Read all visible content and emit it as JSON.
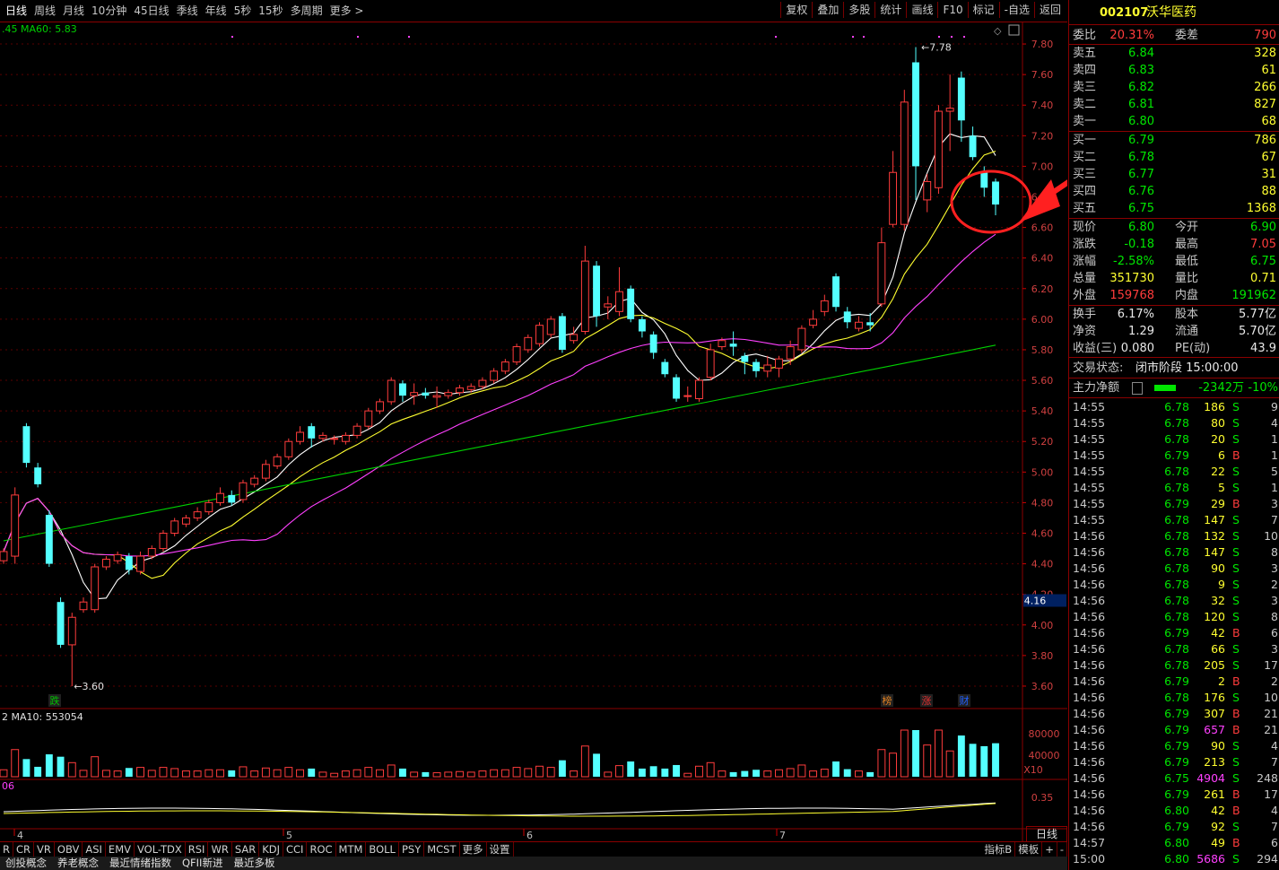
{
  "toolbar": {
    "periods": [
      "日线",
      "周线",
      "月线",
      "10分钟",
      "45日线",
      "季线",
      "年线",
      "5秒",
      "15秒",
      "多周期",
      "更多 >"
    ],
    "actions": [
      "复权",
      "叠加",
      "多股",
      "统计",
      "画线",
      "F10",
      "标记",
      "-自选",
      "返回"
    ]
  },
  "chart": {
    "ma_legend": ".45  MA60: 5.83",
    "vol_legend": "2  MA10: 553054",
    "macd_legend": "06",
    "price_axis": [
      "7.80",
      "7.60",
      "7.40",
      "7.20",
      "7.00",
      "6.80",
      "6.60",
      "6.40",
      "6.20",
      "6.00",
      "5.80",
      "5.60",
      "5.40",
      "5.20",
      "5.00",
      "4.80",
      "4.60",
      "4.40",
      "4.20",
      "4.00",
      "3.80",
      "3.60"
    ],
    "price_marker": "4.16",
    "vol_axis": [
      "80000",
      "40000",
      "X10"
    ],
    "macd_axis": [
      "0.35"
    ],
    "high_label": "7.78",
    "low_label": "3.60",
    "month_labels": [
      "4",
      "5",
      "6",
      "7"
    ],
    "event_tags": [
      "跌",
      "榜",
      "涨",
      "财"
    ],
    "period_btn": "日线",
    "chart_data": {
      "type": "candlestick",
      "ylim": [
        3.5,
        7.9
      ],
      "candles": [
        {
          "o": 4.42,
          "c": 4.48,
          "h": 4.5,
          "l": 4.4
        },
        {
          "o": 4.45,
          "c": 4.85,
          "h": 4.9,
          "l": 4.4
        },
        {
          "o": 5.3,
          "c": 5.06,
          "h": 5.32,
          "l": 5.03
        },
        {
          "o": 5.03,
          "c": 4.92,
          "h": 5.06,
          "l": 4.9
        },
        {
          "o": 4.72,
          "c": 4.4,
          "h": 4.75,
          "l": 4.38
        },
        {
          "o": 4.15,
          "c": 3.87,
          "h": 4.18,
          "l": 3.85
        },
        {
          "o": 3.87,
          "c": 4.05,
          "h": 4.08,
          "l": 3.6
        },
        {
          "o": 4.1,
          "c": 4.15,
          "h": 4.18,
          "l": 4.08
        },
        {
          "o": 4.1,
          "c": 4.38,
          "h": 4.4,
          "l": 4.08
        },
        {
          "o": 4.38,
          "c": 4.43,
          "h": 4.45,
          "l": 4.36
        },
        {
          "o": 4.42,
          "c": 4.46,
          "h": 4.48,
          "l": 4.4
        },
        {
          "o": 4.45,
          "c": 4.36,
          "h": 4.47,
          "l": 4.33
        },
        {
          "o": 4.35,
          "c": 4.45,
          "h": 4.48,
          "l": 4.33
        },
        {
          "o": 4.45,
          "c": 4.5,
          "h": 4.52,
          "l": 4.43
        },
        {
          "o": 4.5,
          "c": 4.6,
          "h": 4.62,
          "l": 4.48
        },
        {
          "o": 4.6,
          "c": 4.68,
          "h": 4.7,
          "l": 4.58
        },
        {
          "o": 4.66,
          "c": 4.7,
          "h": 4.72,
          "l": 4.64
        },
        {
          "o": 4.7,
          "c": 4.74,
          "h": 4.77,
          "l": 4.68
        },
        {
          "o": 4.74,
          "c": 4.8,
          "h": 4.82,
          "l": 4.72
        },
        {
          "o": 4.8,
          "c": 4.86,
          "h": 4.9,
          "l": 4.78
        },
        {
          "o": 4.85,
          "c": 4.8,
          "h": 4.88,
          "l": 4.78
        },
        {
          "o": 4.82,
          "c": 4.93,
          "h": 4.95,
          "l": 4.8
        },
        {
          "o": 4.92,
          "c": 4.96,
          "h": 4.98,
          "l": 4.9
        },
        {
          "o": 4.96,
          "c": 5.05,
          "h": 5.08,
          "l": 4.94
        },
        {
          "o": 5.04,
          "c": 5.1,
          "h": 5.12,
          "l": 5.02
        },
        {
          "o": 5.1,
          "c": 5.2,
          "h": 5.22,
          "l": 5.08
        },
        {
          "o": 5.2,
          "c": 5.26,
          "h": 5.3,
          "l": 5.18
        },
        {
          "o": 5.3,
          "c": 5.22,
          "h": 5.32,
          "l": 5.16
        },
        {
          "o": 5.22,
          "c": 5.24,
          "h": 5.26,
          "l": 5.2
        },
        {
          "o": 5.22,
          "c": 5.22,
          "h": 5.24,
          "l": 5.18
        },
        {
          "o": 5.2,
          "c": 5.24,
          "h": 5.26,
          "l": 5.18
        },
        {
          "o": 5.24,
          "c": 5.3,
          "h": 5.32,
          "l": 5.22
        },
        {
          "o": 5.3,
          "c": 5.4,
          "h": 5.42,
          "l": 5.28
        },
        {
          "o": 5.4,
          "c": 5.46,
          "h": 5.48,
          "l": 5.38
        },
        {
          "o": 5.46,
          "c": 5.6,
          "h": 5.62,
          "l": 5.44
        },
        {
          "o": 5.58,
          "c": 5.5,
          "h": 5.6,
          "l": 5.46
        },
        {
          "o": 5.5,
          "c": 5.52,
          "h": 5.58,
          "l": 5.44
        },
        {
          "o": 5.52,
          "c": 5.5,
          "h": 5.55,
          "l": 5.48
        },
        {
          "o": 5.49,
          "c": 5.5,
          "h": 5.56,
          "l": 5.42
        },
        {
          "o": 5.5,
          "c": 5.52,
          "h": 5.54,
          "l": 5.48
        },
        {
          "o": 5.52,
          "c": 5.55,
          "h": 5.57,
          "l": 5.5
        },
        {
          "o": 5.54,
          "c": 5.56,
          "h": 5.58,
          "l": 5.52
        },
        {
          "o": 5.56,
          "c": 5.6,
          "h": 5.62,
          "l": 5.54
        },
        {
          "o": 5.6,
          "c": 5.66,
          "h": 5.68,
          "l": 5.58
        },
        {
          "o": 5.66,
          "c": 5.72,
          "h": 5.74,
          "l": 5.64
        },
        {
          "o": 5.72,
          "c": 5.82,
          "h": 5.84,
          "l": 5.7
        },
        {
          "o": 5.8,
          "c": 5.88,
          "h": 5.9,
          "l": 5.78
        },
        {
          "o": 5.84,
          "c": 5.96,
          "h": 5.98,
          "l": 5.82
        },
        {
          "o": 5.9,
          "c": 6.0,
          "h": 6.02,
          "l": 5.88
        },
        {
          "o": 6.02,
          "c": 5.8,
          "h": 6.04,
          "l": 5.78
        },
        {
          "o": 5.86,
          "c": 5.9,
          "h": 5.95,
          "l": 5.84
        },
        {
          "o": 5.92,
          "c": 6.38,
          "h": 6.48,
          "l": 5.9
        },
        {
          "o": 6.35,
          "c": 6.02,
          "h": 6.38,
          "l": 5.95
        },
        {
          "o": 6.08,
          "c": 6.1,
          "h": 6.15,
          "l": 6.0
        },
        {
          "o": 6.05,
          "c": 6.18,
          "h": 6.34,
          "l": 6.02
        },
        {
          "o": 6.2,
          "c": 6.0,
          "h": 6.22,
          "l": 5.98
        },
        {
          "o": 6.0,
          "c": 5.92,
          "h": 6.02,
          "l": 5.88
        },
        {
          "o": 5.9,
          "c": 5.78,
          "h": 5.92,
          "l": 5.74
        },
        {
          "o": 5.72,
          "c": 5.64,
          "h": 5.74,
          "l": 5.62
        },
        {
          "o": 5.62,
          "c": 5.48,
          "h": 5.64,
          "l": 5.46
        },
        {
          "o": 5.5,
          "c": 5.5,
          "h": 5.56,
          "l": 5.46
        },
        {
          "o": 5.48,
          "c": 5.6,
          "h": 5.62,
          "l": 5.46
        },
        {
          "o": 5.62,
          "c": 5.8,
          "h": 5.84,
          "l": 5.6
        },
        {
          "o": 5.82,
          "c": 5.86,
          "h": 5.88,
          "l": 5.8
        },
        {
          "o": 5.84,
          "c": 5.82,
          "h": 5.92,
          "l": 5.76
        },
        {
          "o": 5.76,
          "c": 5.72,
          "h": 5.78,
          "l": 5.64
        },
        {
          "o": 5.72,
          "c": 5.66,
          "h": 5.74,
          "l": 5.62
        },
        {
          "o": 5.66,
          "c": 5.7,
          "h": 5.76,
          "l": 5.62
        },
        {
          "o": 5.68,
          "c": 5.74,
          "h": 5.76,
          "l": 5.62
        },
        {
          "o": 5.74,
          "c": 5.82,
          "h": 5.86,
          "l": 5.7
        },
        {
          "o": 5.8,
          "c": 5.94,
          "h": 5.96,
          "l": 5.78
        },
        {
          "o": 5.96,
          "c": 6.0,
          "h": 6.06,
          "l": 5.94
        },
        {
          "o": 6.05,
          "c": 6.12,
          "h": 6.16,
          "l": 6.02
        },
        {
          "o": 6.28,
          "c": 6.08,
          "h": 6.3,
          "l": 6.05
        },
        {
          "o": 6.05,
          "c": 5.98,
          "h": 6.08,
          "l": 5.94
        },
        {
          "o": 5.94,
          "c": 5.98,
          "h": 6.02,
          "l": 5.92
        },
        {
          "o": 5.98,
          "c": 5.96,
          "h": 6.04,
          "l": 5.92
        },
        {
          "o": 6.1,
          "c": 6.5,
          "h": 6.6,
          "l": 6.08
        },
        {
          "o": 6.62,
          "c": 6.96,
          "h": 7.1,
          "l": 6.6
        },
        {
          "o": 6.62,
          "c": 7.42,
          "h": 7.5,
          "l": 6.58
        },
        {
          "o": 7.68,
          "c": 7.0,
          "h": 7.78,
          "l": 6.78
        },
        {
          "o": 6.78,
          "c": 6.9,
          "h": 6.95,
          "l": 6.7
        },
        {
          "o": 6.86,
          "c": 7.36,
          "h": 7.4,
          "l": 6.82
        },
        {
          "o": 7.36,
          "c": 7.38,
          "h": 7.6,
          "l": 7.1
        },
        {
          "o": 7.58,
          "c": 7.3,
          "h": 7.62,
          "l": 7.16
        },
        {
          "o": 7.2,
          "c": 7.06,
          "h": 7.26,
          "l": 7.04
        },
        {
          "o": 6.96,
          "c": 6.86,
          "h": 7.0,
          "l": 6.8
        },
        {
          "o": 6.9,
          "c": 6.75,
          "h": 6.92,
          "l": 6.68
        }
      ],
      "ma5_color": "#ffffff",
      "ma10_color": "#ffff30",
      "ma20_color": "#ff40ff",
      "ma60_color": "#00d000",
      "volume_max": 110000
    }
  },
  "panel": {
    "code": "002107",
    "name": "沃华医药",
    "weibi_label": "委比",
    "weibi": "20.31%",
    "weicha_label": "委差",
    "weicha": "790",
    "asks": [
      {
        "label": "卖五",
        "price": "6.84",
        "vol": "328"
      },
      {
        "label": "卖四",
        "price": "6.83",
        "vol": "61"
      },
      {
        "label": "卖三",
        "price": "6.82",
        "vol": "266"
      },
      {
        "label": "卖二",
        "price": "6.81",
        "vol": "827"
      },
      {
        "label": "卖一",
        "price": "6.80",
        "vol": "68"
      }
    ],
    "bids": [
      {
        "label": "买一",
        "price": "6.79",
        "vol": "786"
      },
      {
        "label": "买二",
        "price": "6.78",
        "vol": "67"
      },
      {
        "label": "买三",
        "price": "6.77",
        "vol": "31"
      },
      {
        "label": "买四",
        "price": "6.76",
        "vol": "88"
      },
      {
        "label": "买五",
        "price": "6.75",
        "vol": "1368"
      }
    ],
    "stats": [
      {
        "l1": "现价",
        "v1": "6.80",
        "c1": "grn",
        "l2": "今开",
        "v2": "6.90",
        "c2": "grn"
      },
      {
        "l1": "涨跌",
        "v1": "-0.18",
        "c1": "grn",
        "l2": "最高",
        "v2": "7.05",
        "c2": "red"
      },
      {
        "l1": "涨幅",
        "v1": "-2.58%",
        "c1": "grn",
        "l2": "最低",
        "v2": "6.75",
        "c2": "grn"
      },
      {
        "l1": "总量",
        "v1": "351730",
        "c1": "yel",
        "l2": "量比",
        "v2": "0.71",
        "c2": "yel"
      },
      {
        "l1": "外盘",
        "v1": "159768",
        "c1": "red",
        "l2": "内盘",
        "v2": "191962",
        "c2": "grn"
      }
    ],
    "fund": [
      {
        "l1": "换手",
        "v1": "6.17%",
        "l2": "股本",
        "v2": "5.77亿"
      },
      {
        "l1": "净资",
        "v1": "1.29",
        "l2": "流通",
        "v2": "5.70亿"
      },
      {
        "l1": "收益(三)",
        "v1": "0.080",
        "l2": "PE(动)",
        "v2": "43.9"
      }
    ],
    "trade_status_label": "交易状态:",
    "trade_status": "闭市阶段 15:00:00",
    "main_flow_label": "主力净额",
    "main_flow": "-2342万",
    "main_flow_pct": "-10%",
    "ticks": [
      {
        "t": "14:55",
        "p": "6.78",
        "q": "186",
        "d": "S",
        "n": "9"
      },
      {
        "t": "14:55",
        "p": "6.78",
        "q": "80",
        "d": "S",
        "n": "4"
      },
      {
        "t": "14:55",
        "p": "6.78",
        "q": "20",
        "d": "S",
        "n": "1"
      },
      {
        "t": "14:55",
        "p": "6.79",
        "q": "6",
        "d": "B",
        "n": "1"
      },
      {
        "t": "14:55",
        "p": "6.78",
        "q": "22",
        "d": "S",
        "n": "5"
      },
      {
        "t": "14:55",
        "p": "6.78",
        "q": "5",
        "d": "S",
        "n": "1"
      },
      {
        "t": "14:55",
        "p": "6.79",
        "q": "29",
        "d": "B",
        "n": "3"
      },
      {
        "t": "14:55",
        "p": "6.78",
        "q": "147",
        "d": "S",
        "n": "7"
      },
      {
        "t": "14:56",
        "p": "6.78",
        "q": "132",
        "d": "S",
        "n": "10"
      },
      {
        "t": "14:56",
        "p": "6.78",
        "q": "147",
        "d": "S",
        "n": "8"
      },
      {
        "t": "14:56",
        "p": "6.78",
        "q": "90",
        "d": "S",
        "n": "3"
      },
      {
        "t": "14:56",
        "p": "6.78",
        "q": "9",
        "d": "S",
        "n": "2"
      },
      {
        "t": "14:56",
        "p": "6.78",
        "q": "32",
        "d": "S",
        "n": "3"
      },
      {
        "t": "14:56",
        "p": "6.78",
        "q": "120",
        "d": "S",
        "n": "8"
      },
      {
        "t": "14:56",
        "p": "6.79",
        "q": "42",
        "d": "B",
        "n": "6"
      },
      {
        "t": "14:56",
        "p": "6.78",
        "q": "66",
        "d": "S",
        "n": "3"
      },
      {
        "t": "14:56",
        "p": "6.78",
        "q": "205",
        "d": "S",
        "n": "17"
      },
      {
        "t": "14:56",
        "p": "6.79",
        "q": "2",
        "d": "B",
        "n": "2"
      },
      {
        "t": "14:56",
        "p": "6.78",
        "q": "176",
        "d": "S",
        "n": "10"
      },
      {
        "t": "14:56",
        "p": "6.79",
        "q": "307",
        "d": "B",
        "n": "21"
      },
      {
        "t": "14:56",
        "p": "6.79",
        "q": "657",
        "d": "B",
        "n": "21"
      },
      {
        "t": "14:56",
        "p": "6.79",
        "q": "90",
        "d": "S",
        "n": "4"
      },
      {
        "t": "14:56",
        "p": "6.79",
        "q": "213",
        "d": "S",
        "n": "7"
      },
      {
        "t": "14:56",
        "p": "6.75",
        "q": "4904",
        "d": "S",
        "n": "248"
      },
      {
        "t": "14:56",
        "p": "6.79",
        "q": "261",
        "d": "B",
        "n": "17"
      },
      {
        "t": "14:56",
        "p": "6.80",
        "q": "42",
        "d": "B",
        "n": "4"
      },
      {
        "t": "14:56",
        "p": "6.79",
        "q": "92",
        "d": "S",
        "n": "7"
      },
      {
        "t": "14:57",
        "p": "6.80",
        "q": "49",
        "d": "B",
        "n": "6"
      },
      {
        "t": "15:00",
        "p": "6.80",
        "q": "5686",
        "d": "S",
        "n": "294"
      }
    ]
  },
  "indicators": [
    "R",
    "CR",
    "VR",
    "OBV",
    "ASI",
    "EMV",
    "VOL-TDX",
    "RSI",
    "WR",
    "SAR",
    "KDJ",
    "CCI",
    "ROC",
    "MTM",
    "BOLL",
    "PSY",
    "MCST",
    "更多",
    "设置"
  ],
  "indicator_right": [
    "指标B",
    "模板",
    "+",
    "-"
  ],
  "status_tabs": [
    "创投概念",
    "养老概念",
    "最近情绪指数",
    "QFII新进",
    "最近多板"
  ]
}
